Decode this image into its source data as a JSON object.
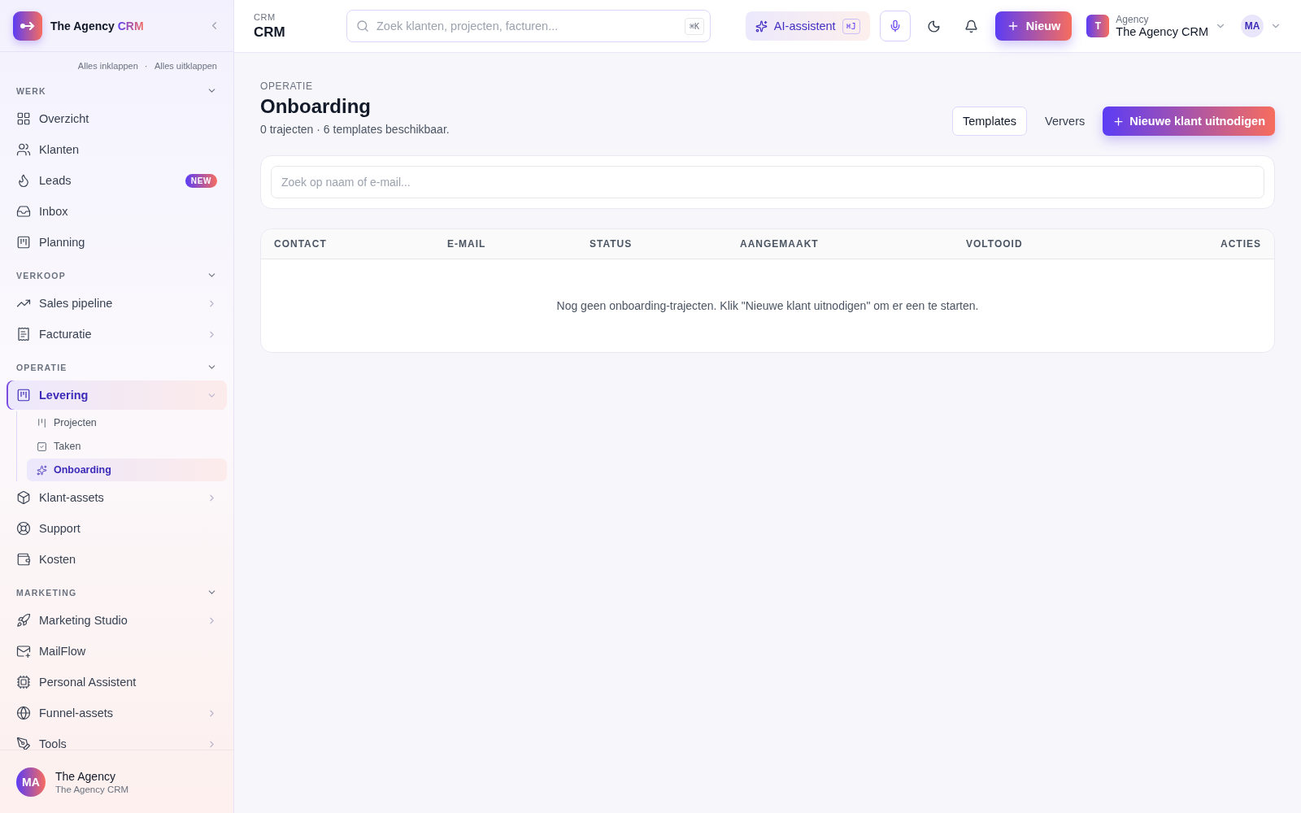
{
  "brand": {
    "name": "The Agency",
    "accent": "CRM"
  },
  "sidebar": {
    "collapse_all": "Alles inklappen",
    "separator": "·",
    "expand_all": "Alles uitklappen",
    "sections": [
      {
        "title": "WERK",
        "expanded": true,
        "items": [
          {
            "label": "Overzicht",
            "selected": false
          },
          {
            "label": "Klanten",
            "selected": false
          },
          {
            "label": "Leads",
            "selected": false,
            "badge": "NEW"
          },
          {
            "label": "Inbox",
            "selected": false
          },
          {
            "label": "Planning",
            "selected": false
          }
        ]
      },
      {
        "title": "VERKOOP",
        "expanded": true,
        "items": [
          {
            "label": "Sales pipeline",
            "selected": false,
            "expandable": true,
            "expanded": false
          },
          {
            "label": "Facturatie",
            "selected": false,
            "expandable": true,
            "expanded": false
          }
        ]
      },
      {
        "title": "OPERATIE",
        "expanded": true,
        "items": [
          {
            "label": "Levering",
            "selected": true,
            "expandable": true,
            "expanded": true,
            "children": [
              {
                "label": "Projecten",
                "selected": false
              },
              {
                "label": "Taken",
                "selected": false
              },
              {
                "label": "Onboarding",
                "selected": true
              }
            ]
          },
          {
            "label": "Klant-assets",
            "selected": false,
            "expandable": true,
            "expanded": false
          },
          {
            "label": "Support",
            "selected": false
          },
          {
            "label": "Kosten",
            "selected": false
          }
        ]
      },
      {
        "title": "MARKETING",
        "expanded": true,
        "items": [
          {
            "label": "Marketing Studio",
            "selected": false,
            "expandable": true,
            "expanded": false
          },
          {
            "label": "MailFlow",
            "selected": false
          },
          {
            "label": "Personal Assistent",
            "selected": false
          },
          {
            "label": "Funnel-assets",
            "selected": false,
            "expandable": true,
            "expanded": false
          },
          {
            "label": "Tools",
            "selected": false,
            "expandable": true,
            "expanded": false
          }
        ]
      }
    ],
    "user": {
      "avatar": "MA",
      "name": "The Agency",
      "org": "The Agency CRM"
    }
  },
  "header": {
    "eyebrow": "CRM",
    "title": "CRM",
    "search": {
      "placeholder": "Zoek klanten, projecten, facturen...",
      "shortcut": "⌘K"
    },
    "ai": {
      "label": "AI-assistent",
      "shortcut": "⌘J"
    },
    "new_button": "Nieuw",
    "workspace": {
      "initial": "T",
      "label": "Agency",
      "name": "The Agency CRM"
    },
    "avatar": "MA"
  },
  "page": {
    "eyebrow": "OPERATIE",
    "title": "Onboarding",
    "subtitle": "0 trajecten · 6 templates beschikbaar.",
    "actions": [
      {
        "label": "Templates",
        "kind": "outline"
      },
      {
        "label": "Ververs",
        "kind": "ghost"
      },
      {
        "label": "Nieuwe klant uitnodigen",
        "kind": "primary"
      }
    ],
    "filter": {
      "placeholder": "Zoek op naam of e-mail..."
    },
    "table": {
      "columns": [
        "CONTACT",
        "E-MAIL",
        "STATUS",
        "AANGEMAAKT",
        "VOLTOOID",
        "ACTIES"
      ],
      "empty": "Nog geen onboarding-trajecten. Klik \"Nieuwe klant uitnodigen\" om er een te starten."
    }
  }
}
